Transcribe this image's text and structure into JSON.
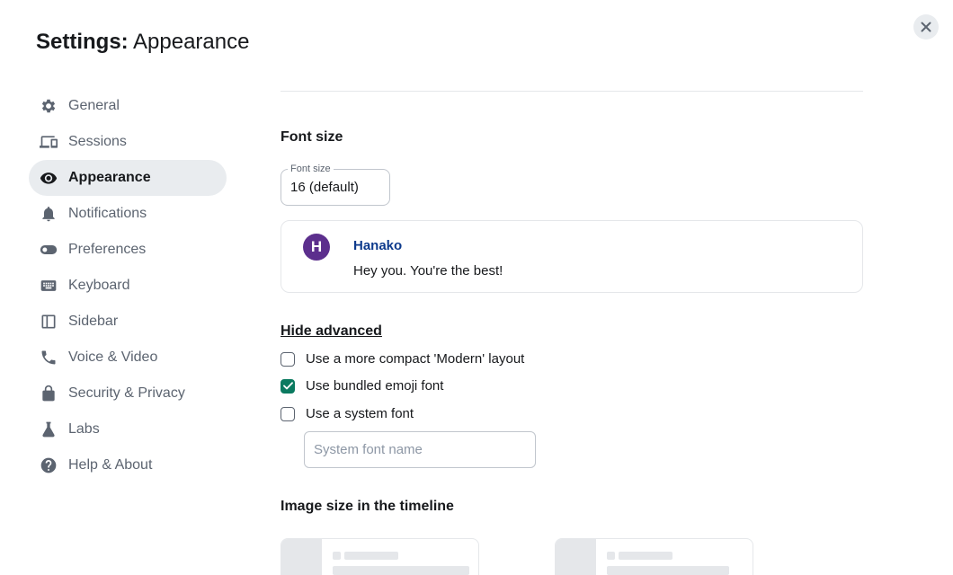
{
  "dialog": {
    "title_prefix": "Settings:",
    "title_section": "Appearance",
    "close_label": "Close"
  },
  "sidebar": {
    "items": [
      {
        "label": "General",
        "icon": "gear-icon"
      },
      {
        "label": "Sessions",
        "icon": "devices-icon"
      },
      {
        "label": "Appearance",
        "icon": "eye-icon",
        "active": true
      },
      {
        "label": "Notifications",
        "icon": "bell-icon"
      },
      {
        "label": "Preferences",
        "icon": "toggle-icon"
      },
      {
        "label": "Keyboard",
        "icon": "keyboard-icon"
      },
      {
        "label": "Sidebar",
        "icon": "sidebar-icon"
      },
      {
        "label": "Voice & Video",
        "icon": "phone-icon"
      },
      {
        "label": "Security & Privacy",
        "icon": "lock-icon"
      },
      {
        "label": "Labs",
        "icon": "flask-icon"
      },
      {
        "label": "Help & About",
        "icon": "help-icon"
      }
    ]
  },
  "font_size": {
    "heading": "Font size",
    "field_label": "Font size",
    "value": "16 (default)"
  },
  "preview": {
    "avatar_letter": "H",
    "sender": "Hanako",
    "message": "Hey you. You're the best!"
  },
  "advanced": {
    "toggle_label": "Hide advanced",
    "options": [
      {
        "label": "Use a more compact 'Modern' layout",
        "checked": false
      },
      {
        "label": "Use bundled emoji font",
        "checked": true
      },
      {
        "label": "Use a system font",
        "checked": false
      }
    ],
    "system_font_placeholder": "System font name"
  },
  "image_size": {
    "heading": "Image size in the timeline"
  },
  "colors": {
    "accent": "#0b7a60",
    "sender": "#0d3a8c",
    "avatar": "#5c2f8d",
    "active_bg": "#e9ecef"
  }
}
